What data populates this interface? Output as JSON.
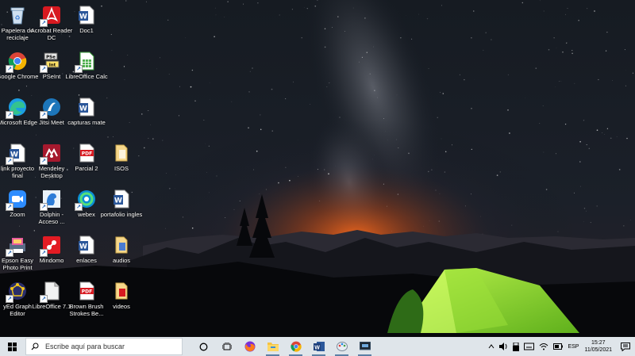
{
  "desktop": {
    "icons": [
      {
        "id": "papelera",
        "label": "Papelera de reciclaje"
      },
      {
        "id": "acrobat",
        "label": "Acrobat Reader DC"
      },
      {
        "id": "doc1",
        "label": "Doc1"
      },
      {
        "id": "chrome",
        "label": "Google Chrome"
      },
      {
        "id": "pseint",
        "label": "PSeInt"
      },
      {
        "id": "calc",
        "label": "LibreOffice Calc"
      },
      {
        "id": "edge",
        "label": "Microsoft Edge"
      },
      {
        "id": "jitsi",
        "label": "Jitsi Meet"
      },
      {
        "id": "capturas",
        "label": "capturas mate"
      },
      {
        "id": "linkproyecto",
        "label": "link proyecto final"
      },
      {
        "id": "mendeley",
        "label": "Mendeley Desktop"
      },
      {
        "id": "parcial2",
        "label": "Parcial 2"
      },
      {
        "id": "isos",
        "label": "ISOS"
      },
      {
        "id": "zoom",
        "label": "Zoom"
      },
      {
        "id": "dolphin",
        "label": "Dolphin - Acceso ..."
      },
      {
        "id": "webex",
        "label": "webex"
      },
      {
        "id": "portafolio",
        "label": "portafolio ingles"
      },
      {
        "id": "epson",
        "label": "Epson Easy Photo Print"
      },
      {
        "id": "mindomo",
        "label": "Mindomo"
      },
      {
        "id": "enlaces",
        "label": "enlaces"
      },
      {
        "id": "audios",
        "label": "audios"
      },
      {
        "id": "yed",
        "label": "yEd Graph Editor"
      },
      {
        "id": "libreoffice",
        "label": "LibreOffice 7.1"
      },
      {
        "id": "brownbrush",
        "label": "Brown Brush Strokes Be..."
      },
      {
        "id": "videos",
        "label": "videos"
      }
    ]
  },
  "taskbar": {
    "search_placeholder": "Escribe aquí para buscar",
    "apps": [
      "cortana-icon",
      "task-view-icon",
      "firefox-icon",
      "file-explorer-icon",
      "chrome-icon",
      "word-icon",
      "paint-icon",
      "screen-app-icon"
    ],
    "language": "ESP",
    "time": "15:27",
    "date": "11/05/2021"
  },
  "colors": {
    "taskbar": "#dfe5ea",
    "tent": "#7bd02a",
    "horizon_glow": "#ff6a1a"
  }
}
